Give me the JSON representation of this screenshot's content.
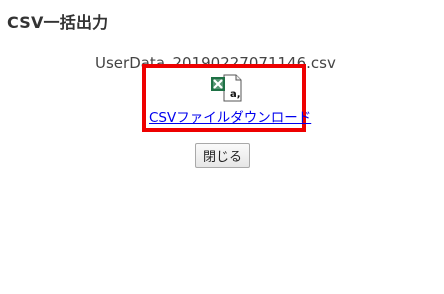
{
  "page": {
    "title": "CSV一括出力"
  },
  "file": {
    "name": "UserData_20190227071146.csv"
  },
  "download": {
    "icon": "excel-csv-file-icon",
    "link_label": "CSVファイルダウンロード"
  },
  "actions": {
    "close_label": "閉じる"
  },
  "colors": {
    "highlight_border": "#ee0000",
    "link": "#0000ee",
    "excel_green": "#1e7145"
  }
}
